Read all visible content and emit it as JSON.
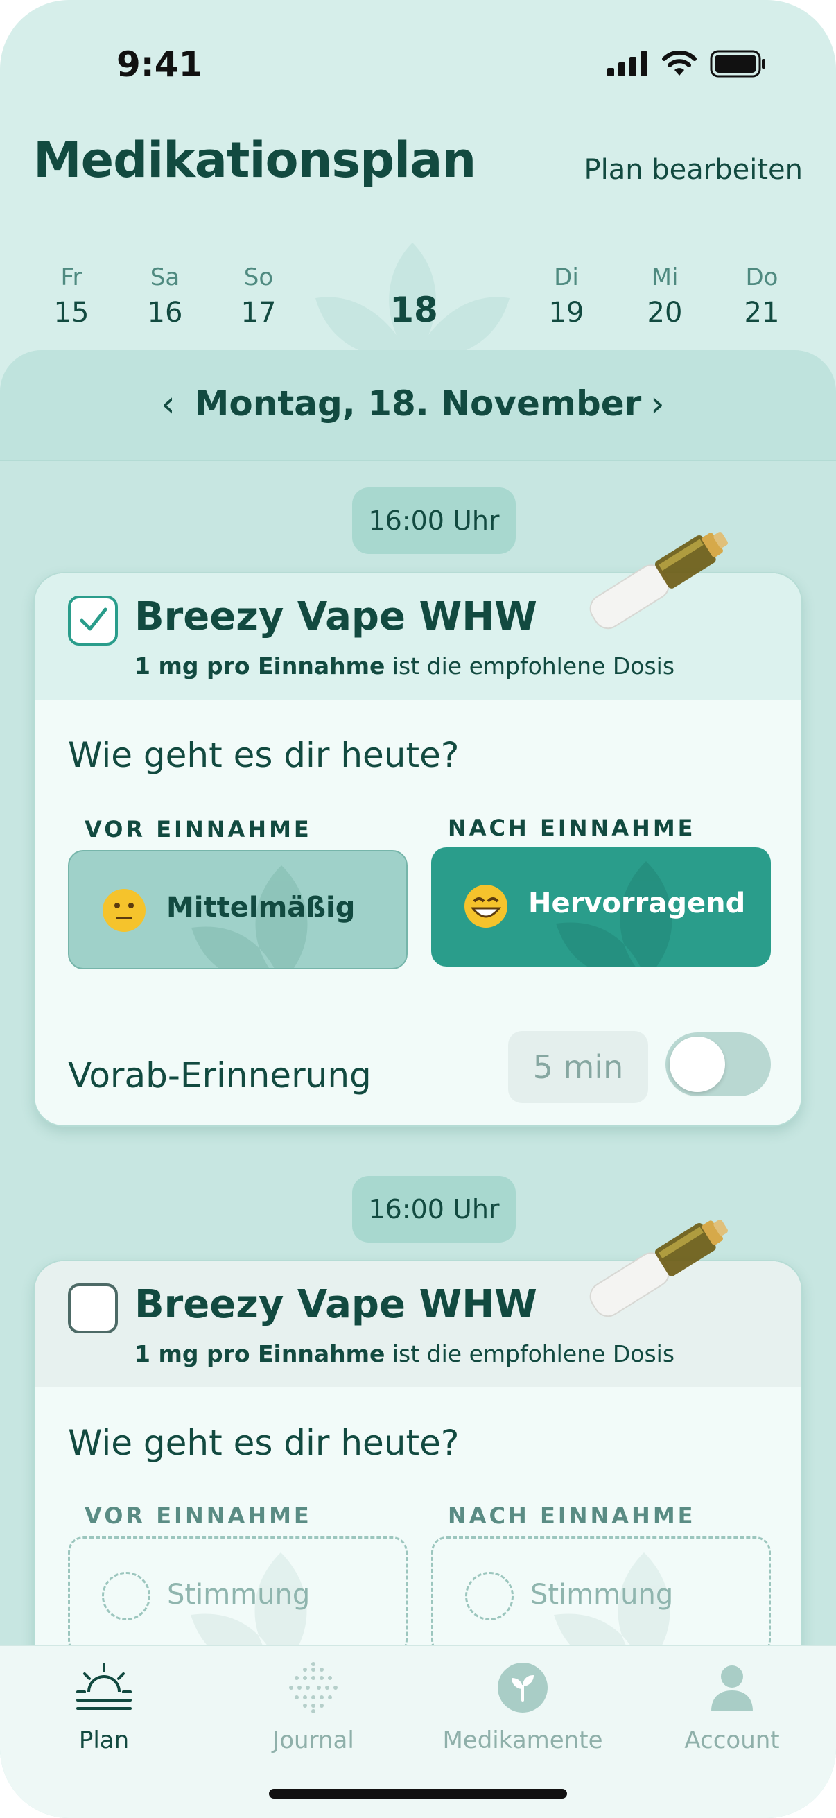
{
  "status": {
    "time": "9:41"
  },
  "header": {
    "title": "Medikationsplan",
    "edit_label": "Plan bearbeiten"
  },
  "week": {
    "days": [
      {
        "name": "Fr",
        "num": "15"
      },
      {
        "name": "Sa",
        "num": "16"
      },
      {
        "name": "So",
        "num": "17"
      },
      {
        "name": "",
        "num": "18",
        "selected": true
      },
      {
        "name": "Di",
        "num": "19"
      },
      {
        "name": "Mi",
        "num": "20"
      },
      {
        "name": "Do",
        "num": "21"
      }
    ]
  },
  "date_nav": {
    "label": "Montag, 18. November",
    "prev": "‹",
    "next": "›"
  },
  "doses": [
    {
      "time": "16:00 Uhr",
      "checked": true,
      "name": "Breezy Vape WHW",
      "dose_bold": "1 mg pro Einnahme",
      "dose_rest": " ist die empfohlene Dosis",
      "question": "Wie geht es dir heute?",
      "before_label": "VOR EINNAHME",
      "after_label": "NACH EINNAHME",
      "before_mood": "Mittelmäßig",
      "after_mood": "Hervorragend",
      "reminder_label": "Vorab-Erinnerung",
      "reminder_value": "5 min",
      "reminder_on": false
    },
    {
      "time": "16:00 Uhr",
      "checked": false,
      "name": "Breezy Vape WHW",
      "dose_bold": "1 mg pro Einnahme",
      "dose_rest": " ist die empfohlene Dosis",
      "question": "Wie geht es dir heute?",
      "before_label": "VOR EINNAHME",
      "after_label": "NACH EINNAHME",
      "before_placeholder": "Stimmung",
      "after_placeholder": "Stimmung"
    }
  ],
  "tabs": [
    {
      "label": "Plan",
      "icon": "sunrise-icon",
      "active": true
    },
    {
      "label": "Journal",
      "icon": "dots-icon",
      "active": false
    },
    {
      "label": "Medikamente",
      "icon": "sprout-icon",
      "active": false
    },
    {
      "label": "Account",
      "icon": "person-icon",
      "active": false
    }
  ],
  "colors": {
    "accent": "#2a9d8b",
    "dark_text": "#124a40",
    "background": "#d6eeea"
  }
}
